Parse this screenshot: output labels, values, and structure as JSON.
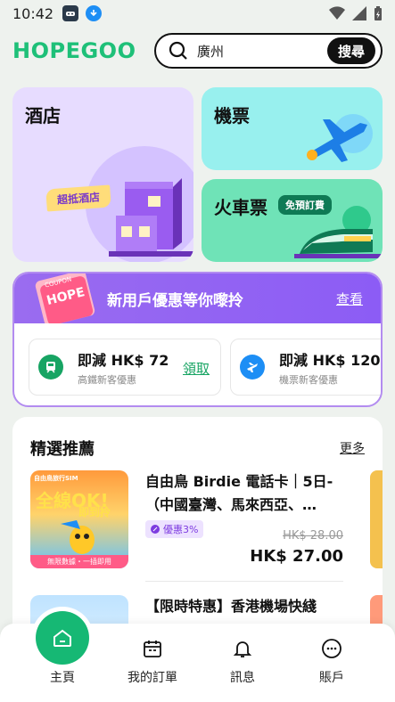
{
  "status_bar": {
    "time": "10:42"
  },
  "header": {
    "logo": "HOPEGOO",
    "search_value": "廣州",
    "search_button": "搜尋"
  },
  "tiles": {
    "hotel": {
      "title": "酒店",
      "tag": "超抵酒店"
    },
    "flight": {
      "title": "機票"
    },
    "train": {
      "title": "火車票",
      "tag": "免預訂費"
    }
  },
  "coupons": {
    "title": "新用戶優惠等你嚟拎",
    "more": "查看",
    "badge": "HOPE",
    "badge_top": "COUPON",
    "items": [
      {
        "amount": "即減 HK$ 72",
        "sub": "高鐵新客優惠",
        "claim": "領取"
      },
      {
        "amount": "即減 HK$ 120",
        "sub": "機票新客優惠"
      }
    ]
  },
  "featured": {
    "title": "精選推薦",
    "more": "更多",
    "products": [
      {
        "title": "自由鳥 Birdie 電話卡｜5日-（中國臺灣、馬來西亞、…",
        "badge": "優惠3%",
        "old_price": "HK$ 28.00",
        "price": "HK$ 27.00",
        "thumb_text_1": "全線OK!",
        "thumb_text_2": "即到拎",
        "thumb_text_top": "自由鳥旅行SIM",
        "thumb_text_bottom": "無限數據・一插即用"
      },
      {
        "title": "【限時特惠】香港機場快綫"
      }
    ]
  },
  "bottom_nav": {
    "items": [
      {
        "label": "主頁",
        "icon": "home-icon"
      },
      {
        "label": "我的訂單",
        "icon": "calendar-icon"
      },
      {
        "label": "訊息",
        "icon": "bell-icon"
      },
      {
        "label": "賬戶",
        "icon": "account-icon"
      }
    ]
  },
  "colors": {
    "brand": "#1ec078",
    "purple": "#9a6cf0"
  }
}
